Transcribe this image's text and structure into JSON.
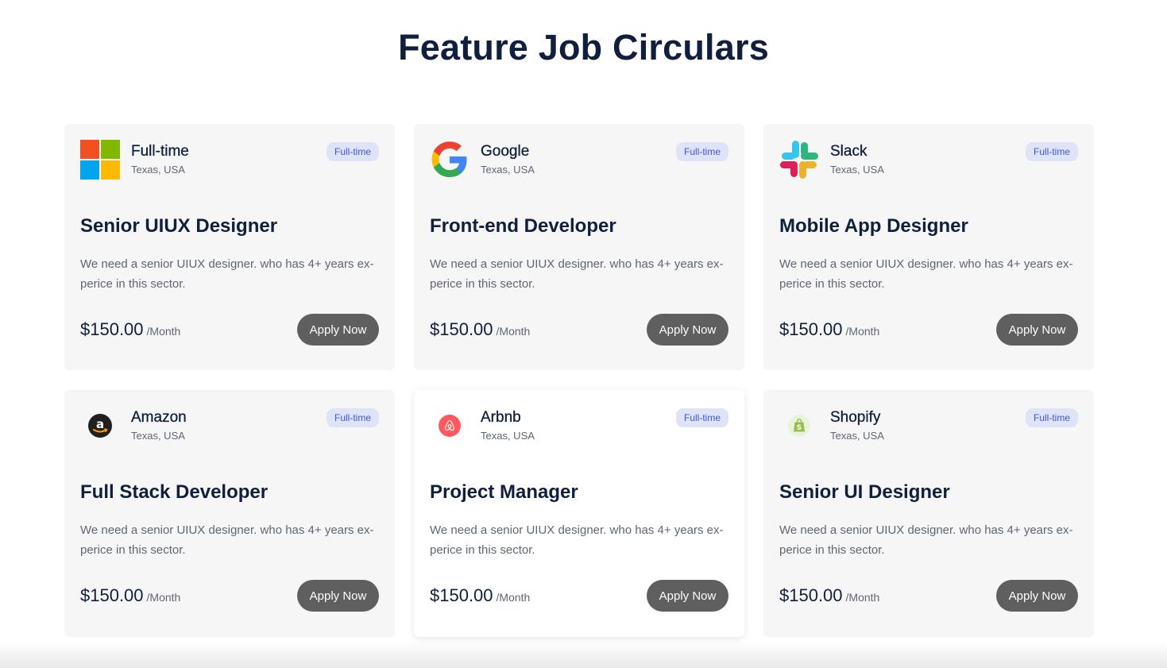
{
  "header": {
    "title": "Feature Job Circulars"
  },
  "jobs": [
    {
      "company": "Full-time",
      "location": "Texas, USA",
      "badge": "Full-time",
      "title": "Senior UIUX Designer",
      "description": "We need a senior UIUX designer. who has 4+ years ex- perice in this sector.",
      "price": "$150.00",
      "period": "/Month",
      "cta": "Apply Now",
      "logo": "microsoft-logo"
    },
    {
      "company": "Google",
      "location": "Texas, USA",
      "badge": "Full-time",
      "title": "Front-end Developer",
      "description": "We need a senior UIUX designer. who has 4+ years ex- perice in this sector.",
      "price": "$150.00",
      "period": "/Month",
      "cta": "Apply Now",
      "logo": "google-logo"
    },
    {
      "company": "Slack",
      "location": "Texas, USA",
      "badge": "Full-time",
      "title": "Mobile App Designer",
      "description": "We need a senior UIUX designer. who has 4+ years ex- perice in this sector.",
      "price": "$150.00",
      "period": "/Month",
      "cta": "Apply Now",
      "logo": "slack-logo"
    },
    {
      "company": "Amazon",
      "location": "Texas, USA",
      "badge": "Full-time",
      "title": "Full Stack Developer",
      "description": "We need a senior UIUX designer. who has 4+ years ex- perice in this sector.",
      "price": "$150.00",
      "period": "/Month",
      "cta": "Apply Now",
      "logo": "amazon-logo"
    },
    {
      "company": "Arbnb",
      "location": "Texas, USA",
      "badge": "Full-time",
      "title": "Project Manager",
      "description": "We need a senior UIUX designer. who has 4+ years ex- perice in this sector.",
      "price": "$150.00",
      "period": "/Month",
      "cta": "Apply Now",
      "logo": "airbnb-logo"
    },
    {
      "company": "Shopify",
      "location": "Texas, USA",
      "badge": "Full-time",
      "title": "Senior UI Designer",
      "description": "We need a senior UIUX designer. who has 4+ years ex- perice in this sector.",
      "price": "$150.00",
      "period": "/Month",
      "cta": "Apply Now",
      "logo": "shopify-logo"
    }
  ],
  "colors": {
    "heading": "#0f1f3d",
    "badge_bg": "#dfe3f8",
    "badge_text": "#3b57d1",
    "button_bg": "#5f5f5f",
    "card_bg": "#f6f6f6"
  }
}
